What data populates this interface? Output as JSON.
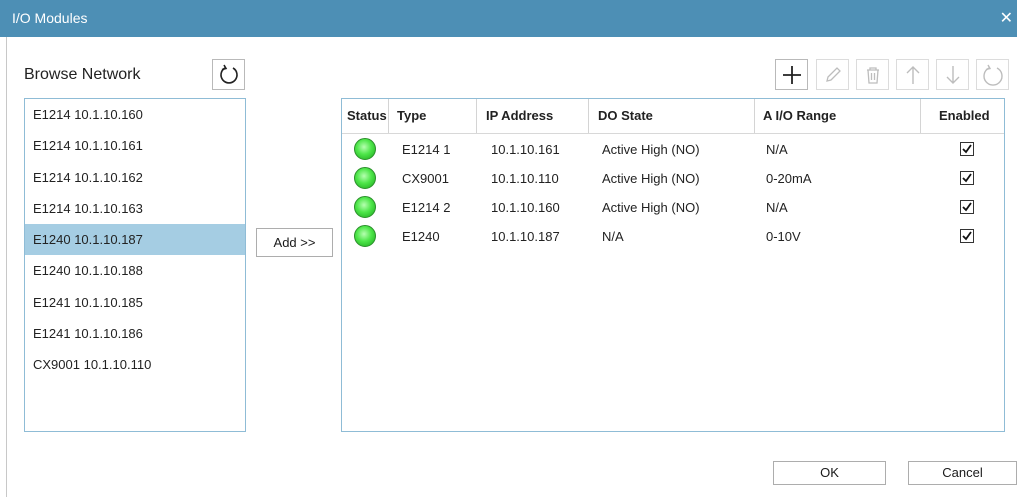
{
  "window": {
    "title": "I/O Modules",
    "close_glyph": "✕"
  },
  "browse": {
    "title": "Browse Network",
    "items": [
      {
        "label": "E1214  10.1.10.160"
      },
      {
        "label": "E1214  10.1.10.161"
      },
      {
        "label": "E1214  10.1.10.162"
      },
      {
        "label": "E1214  10.1.10.163"
      },
      {
        "label": "E1240  10.1.10.187",
        "selected": true
      },
      {
        "label": "E1240  10.1.10.188"
      },
      {
        "label": "E1241  10.1.10.185"
      },
      {
        "label": "E1241  10.1.10.186"
      },
      {
        "label": "CX9001  10.1.10.110"
      }
    ]
  },
  "add_button": {
    "label": "Add >>"
  },
  "toolbar": {
    "icons": [
      "plus-icon",
      "pencil-icon",
      "trash-icon",
      "arrow-up-icon",
      "arrow-down-icon",
      "refresh-icon"
    ]
  },
  "table": {
    "columns": {
      "status": "Status",
      "type": "Type",
      "ip": "IP Address",
      "do_state": "DO State",
      "aio_range": "A I/O Range",
      "enabled": "Enabled"
    },
    "rows": [
      {
        "type": "E1214 1",
        "ip": "10.1.10.161",
        "do_state": "Active High (NO)",
        "aio_range": "N/A",
        "enabled": true,
        "status": "green"
      },
      {
        "type": "CX9001",
        "ip": "10.1.10.110",
        "do_state": "Active High (NO)",
        "aio_range": "0-20mA",
        "enabled": true,
        "status": "green"
      },
      {
        "type": "E1214 2",
        "ip": "10.1.10.160",
        "do_state": "Active High (NO)",
        "aio_range": "N/A",
        "enabled": true,
        "status": "green"
      },
      {
        "type": "E1240",
        "ip": "10.1.10.187",
        "do_state": "N/A",
        "aio_range": "0-10V",
        "enabled": true,
        "status": "green"
      }
    ]
  },
  "dialog": {
    "ok_label": "OK",
    "cancel_label": "Cancel"
  },
  "colors": {
    "titlebar": "#4d8fb5",
    "selection": "#a5cde3",
    "panel_border": "#8fbcd6",
    "status_ok": "#3fd83a"
  }
}
